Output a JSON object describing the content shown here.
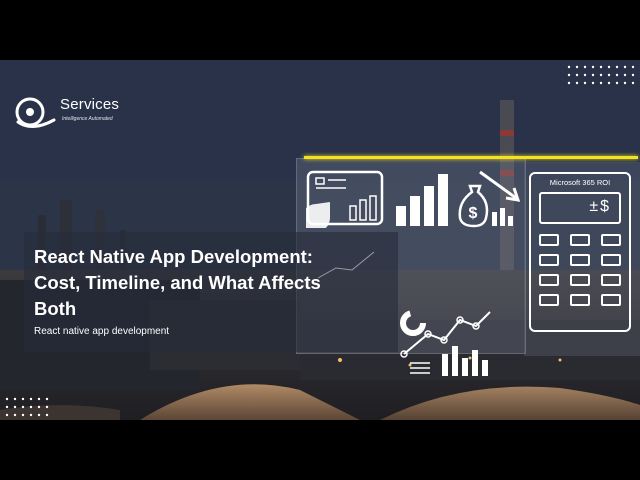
{
  "logo": {
    "word": "Services",
    "tagline": "Intelligence Automated"
  },
  "hero": {
    "title": "React Native App Development: Cost, Timeline, and What Affects Both",
    "subtitle": "React native app development"
  },
  "calculator": {
    "label": "Microsoft 365 ROI",
    "symbol": "±$"
  },
  "colors": {
    "accent": "#f5e021",
    "text": "#ffffff",
    "background": "#000000"
  },
  "icons": [
    "logo-mark-icon",
    "dashboard-icon",
    "bar-chart-icon",
    "money-bag-decline-icon",
    "donut-chart-icon",
    "line-chart-icon",
    "bar-chart-small-icon",
    "calculator-icon"
  ]
}
